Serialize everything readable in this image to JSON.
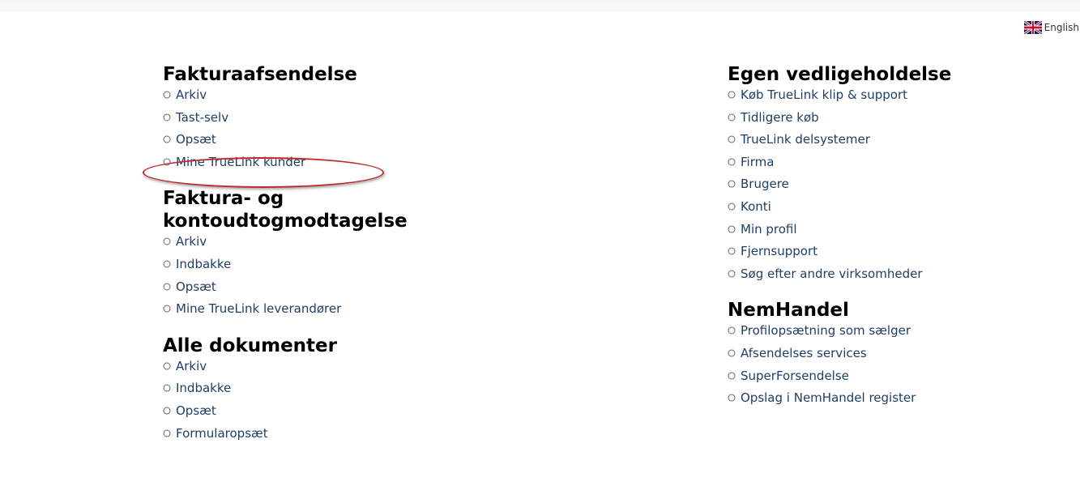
{
  "language": {
    "label": "English",
    "flag_icon": "uk-flag-icon"
  },
  "bullet_icon": "circle-outline-icon",
  "colors": {
    "link": "#1f3f66",
    "heading": "#000000",
    "highlight": "#c0282d"
  },
  "left_column": {
    "sections": [
      {
        "title": "Fakturaafsendelse",
        "items": [
          "Arkiv",
          "Tast-selv",
          "Opsæt",
          "Mine TrueLink kunder"
        ]
      },
      {
        "title": "Faktura- og kontoudtogmodtagelse",
        "items": [
          "Arkiv",
          "Indbakke",
          "Opsæt",
          "Mine TrueLink leverandører"
        ]
      },
      {
        "title": "Alle dokumenter",
        "items": [
          "Arkiv",
          "Indbakke",
          "Opsæt",
          "Formularopsæt"
        ]
      }
    ]
  },
  "right_column": {
    "sections": [
      {
        "title": "Egen vedligeholdelse",
        "items": [
          "Køb TrueLink klip & support",
          "Tidligere køb",
          "TrueLink delsystemer",
          "Firma",
          "Brugere",
          "Konti",
          "Min profil",
          "Fjernsupport",
          "Søg efter andre virksomheder"
        ]
      },
      {
        "title": "NemHandel",
        "items": [
          "Profilopsætning som sælger",
          "Afsendelses services",
          "SuperForsendelse",
          "Opslag i NemHandel register"
        ]
      }
    ]
  }
}
